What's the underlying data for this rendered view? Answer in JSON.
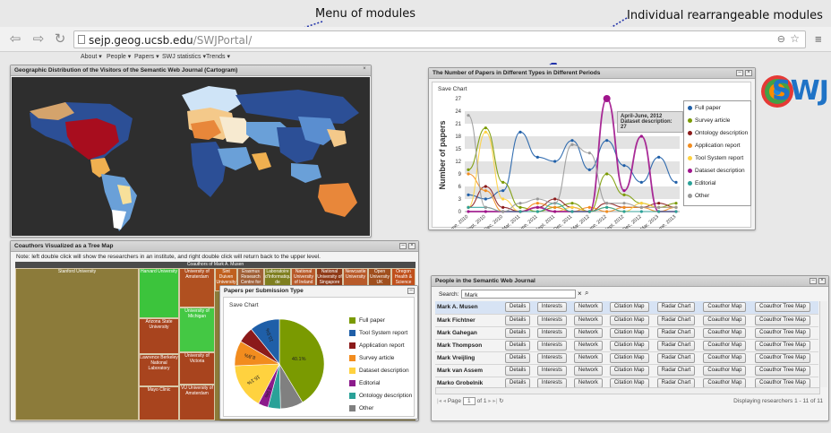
{
  "annotations": {
    "menu_of_modules": "Menu of modules",
    "rearrangeable_modules": "Individual rearrangeable modules"
  },
  "browser": {
    "url_domain": "sejp.geog.ucsb.edu",
    "url_path": "/SWJPortal/"
  },
  "menu": {
    "items": [
      "About ▾",
      "People ▾",
      "Papers ▾",
      "SWJ statistics ▾",
      "Trends ▾"
    ]
  },
  "map_panel": {
    "title": "Geographic Distribution of the Visitors of the Semantic Web Journal (Cartogram)",
    "close": "×"
  },
  "treemap_panel": {
    "title": "Coauthors Visualized as a Tree Map",
    "note": "Note: left double click will show the researchers in an institute, and right double click will return back to the upper level.",
    "header": "Coauthors of Mark A. Musen",
    "cells": [
      "Stanford University",
      "Harvard University",
      "University of Amsterdam",
      "Sint Duiven University of the",
      "Erasmus Research Centre for",
      "Laboratoire d'Informatique de",
      "National University of Ireland",
      "National University of Singapore",
      "Newcastle University",
      "Open University UK",
      "Oregon Health & Science",
      "University of Michigan",
      "Arizona State University",
      "Lawrence Berkeley National Laboratory",
      "University of Victoria",
      "VU University of Amsterdam",
      "Mayo Clinic"
    ]
  },
  "pie_panel": {
    "title": "Papers per Submission Type",
    "save_label": "Save Chart"
  },
  "line_panel": {
    "title": "The Number of Papers in Different Types in Different Periods",
    "save_label": "Save Chart",
    "tooltip_line1": "April-June, 2012",
    "tooltip_line2": "Dataset description: 27"
  },
  "people_panel": {
    "title": "People in the Semantic Web Journal",
    "search_label": "Search:",
    "search_value": "Mark",
    "buttons": [
      "Details",
      "Interests",
      "Network",
      "Citation Map",
      "Radar Chart",
      "Coauthor Map",
      "Coauthor Tree Map"
    ],
    "people": [
      "Mark A. Musen",
      "Mark Fichtner",
      "Mark Gahegan",
      "Mark Thompson",
      "Mark Vreijling",
      "Mark van Assem",
      "Marko Grobelnik"
    ],
    "page_label": "Page",
    "page_value": "1",
    "page_of": "of 1",
    "status": "Displaying researchers 1 - 11 of 11"
  },
  "logo": {
    "text": "SWJ"
  },
  "colors": {
    "full_paper": "#7a9a01",
    "tool_system": "#1f5fa8",
    "application": "#8b1a1a",
    "survey": "#f28c1e",
    "dataset": "#ffd23f",
    "editorial": "#8b1a8b",
    "ontology": "#2aa198",
    "other": "#777777"
  },
  "chart_data": [
    {
      "type": "line",
      "title": "",
      "ylabel": "Number of papers",
      "xlabel": "",
      "ylim": [
        0,
        27
      ],
      "yticks": [
        0,
        3,
        6,
        9,
        12,
        15,
        18,
        21,
        24,
        27
      ],
      "x": [
        "Mar-June, 2010",
        "July-Sept, 2010",
        "Oct-Dec, 2010",
        "Jan-Mar, 2011",
        "April-June, 2011",
        "July-Sept, 2011",
        "Oct-Dec, 2011",
        "Jan-Mar, 2012",
        "April-June, 2012",
        "July-Sept, 2012",
        "Oct-Dec, 2012",
        "Jan-Mar, 2013",
        "April-June, 2013"
      ],
      "legend_position": "right",
      "series": [
        {
          "name": "Full paper",
          "color": "#1f5fa8",
          "values": [
            4,
            3,
            5,
            19,
            13,
            12,
            17,
            10,
            17,
            11,
            7,
            13,
            7
          ]
        },
        {
          "name": "Survey article",
          "color": "#7a9a01",
          "values": [
            10,
            20,
            7,
            1,
            0,
            1,
            2,
            0,
            9,
            4,
            2,
            1,
            2
          ]
        },
        {
          "name": "Ontology description",
          "color": "#8b1a1a",
          "values": [
            1,
            6,
            1,
            0,
            1,
            3,
            1,
            0,
            2,
            1,
            1,
            2,
            1
          ]
        },
        {
          "name": "Application report",
          "color": "#f28c1e",
          "values": [
            9,
            5,
            0,
            0,
            2,
            1,
            0,
            1,
            0,
            1,
            1,
            0,
            1
          ]
        },
        {
          "name": "Tool System report",
          "color": "#ffd23f",
          "values": [
            1,
            19,
            3,
            0,
            1,
            0,
            1,
            0,
            1,
            0,
            2,
            1,
            1
          ]
        },
        {
          "name": "Dataset description",
          "color": "#a0148c",
          "values": [
            0,
            0,
            0,
            0,
            1,
            0,
            0,
            0,
            27,
            5,
            18,
            0,
            0
          ]
        },
        {
          "name": "Editorial",
          "color": "#2aa198",
          "values": [
            1,
            1,
            0,
            0,
            0,
            2,
            0,
            0,
            1,
            0,
            0,
            0,
            0
          ]
        },
        {
          "name": "Other",
          "color": "#999999",
          "values": [
            23,
            1,
            0,
            2,
            3,
            2,
            16,
            14,
            2,
            2,
            1,
            1,
            1
          ]
        }
      ]
    },
    {
      "type": "pie",
      "title": "",
      "legend_position": "right",
      "slices": [
        {
          "name": "Full paper",
          "value": 40.1,
          "label": "40.1%",
          "color": "#7a9a01"
        },
        {
          "name": "Other",
          "value": 8.0,
          "label": "",
          "color": "#808080"
        },
        {
          "name": "Ontology description",
          "value": 4.4,
          "label": "",
          "color": "#2aa198"
        },
        {
          "name": "Editorial",
          "value": 3.5,
          "label": "3.5%",
          "color": "#8b1a8b"
        },
        {
          "name": "Dataset description",
          "value": 16.1,
          "label": "16.1%",
          "color": "#ffd23f"
        },
        {
          "name": "Survey article",
          "value": 8.8,
          "label": "8.8%",
          "color": "#f28c1e"
        },
        {
          "name": "Application report",
          "value": 5.6,
          "label": "",
          "color": "#8b1a1a"
        },
        {
          "name": "Tool System report",
          "value": 10.5,
          "label": "10.5%",
          "color": "#1f5fa8"
        }
      ]
    }
  ]
}
